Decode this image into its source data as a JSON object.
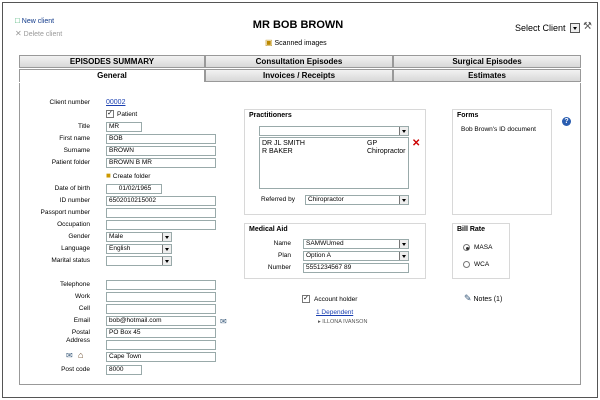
{
  "header": {
    "new_client": "New client",
    "delete_client": "Delete client",
    "client_name": "MR BOB BROWN",
    "scanned_images": "Scanned images",
    "select_client": "Select Client"
  },
  "tabs_top": [
    {
      "label": "EPISODES SUMMARY"
    },
    {
      "label": "Consultation Episodes"
    },
    {
      "label": "Surgical Episodes"
    }
  ],
  "tabs_bottom": [
    {
      "label": "General"
    },
    {
      "label": "Invoices / Receipts"
    },
    {
      "label": "Estimates"
    }
  ],
  "general": {
    "client_number_label": "Client number",
    "client_number": "00002",
    "patient_label": "Patient",
    "title_label": "Title",
    "title": "MR",
    "first_name_label": "First name",
    "first_name": "BOB",
    "surname_label": "Surname",
    "surname": "BROWN",
    "patient_folder_label": "Patient folder",
    "patient_folder": "BROWN B MR",
    "create_folder": "Create folder",
    "dob_label": "Date of birth",
    "dob": "01/02/1965",
    "id_label": "ID number",
    "id_number": "6502010215002",
    "passport_label": "Passport number",
    "occupation_label": "Occupation",
    "gender_label": "Gender",
    "gender": "Male",
    "language_label": "Language",
    "language": "English",
    "marital_label": "Marital status",
    "telephone_label": "Telephone",
    "work_label": "Work",
    "cell_label": "Cell",
    "email_label": "Email",
    "email": "bob@hotmail.com",
    "postal_label": "Postal",
    "address_label": "Address",
    "postal_line1": "PO Box 45",
    "postal_line3": "Cape Town",
    "postcode_label": "Post code",
    "postcode": "8000"
  },
  "practitioners": {
    "title": "Practitioners",
    "rows": [
      {
        "name": "DR JL SMITH",
        "type": "GP"
      },
      {
        "name": "R BAKER",
        "type": "Chiropractor"
      }
    ],
    "referred_by_label": "Referred by",
    "referred_by": "Chiropractor"
  },
  "medical_aid": {
    "title": "Medical Aid",
    "name_label": "Name",
    "name": "SAMWUmed",
    "plan_label": "Plan",
    "plan": "Option A",
    "number_label": "Number",
    "number": "5551234567 89",
    "account_holder_label": "Account holder",
    "dependents_link": "1 Dependent",
    "dependent_name": "ILLONA IVANSON"
  },
  "forms": {
    "title": "Forms",
    "document": "Bob Brown's ID document"
  },
  "bill_rate": {
    "title": "Bill Rate",
    "option1": "MASA",
    "option2": "WCA"
  },
  "notes": {
    "label": "Notes (1)"
  }
}
